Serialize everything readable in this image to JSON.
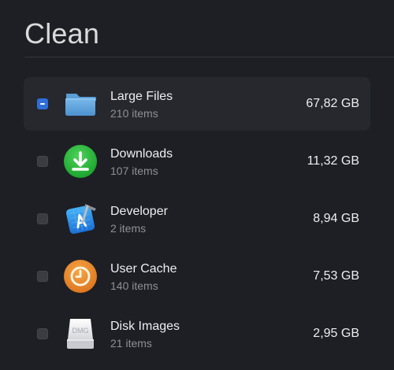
{
  "page": {
    "title": "Clean"
  },
  "items": [
    {
      "name": "Large Files",
      "count": "210 items",
      "size": "67,82 GB",
      "icon": "folder-icon",
      "checked": "mixed"
    },
    {
      "name": "Downloads",
      "count": "107 items",
      "size": "11,32 GB",
      "icon": "download-icon",
      "checked": "unchecked"
    },
    {
      "name": "Developer",
      "count": "2 items",
      "size": "8,94 GB",
      "icon": "xcode-icon",
      "checked": "unchecked"
    },
    {
      "name": "User Cache",
      "count": "140 items",
      "size": "7,53 GB",
      "icon": "clock-icon",
      "checked": "unchecked"
    },
    {
      "name": "Disk Images",
      "count": "21 items",
      "size": "2,95 GB",
      "icon": "dmg-icon",
      "checked": "unchecked",
      "icon_label": "DMG"
    }
  ],
  "colors": {
    "background": "#1d1f24",
    "selected_row": "#26282e",
    "checkbox_accent": "#2f6ed8",
    "secondary_text": "#8e9097"
  }
}
